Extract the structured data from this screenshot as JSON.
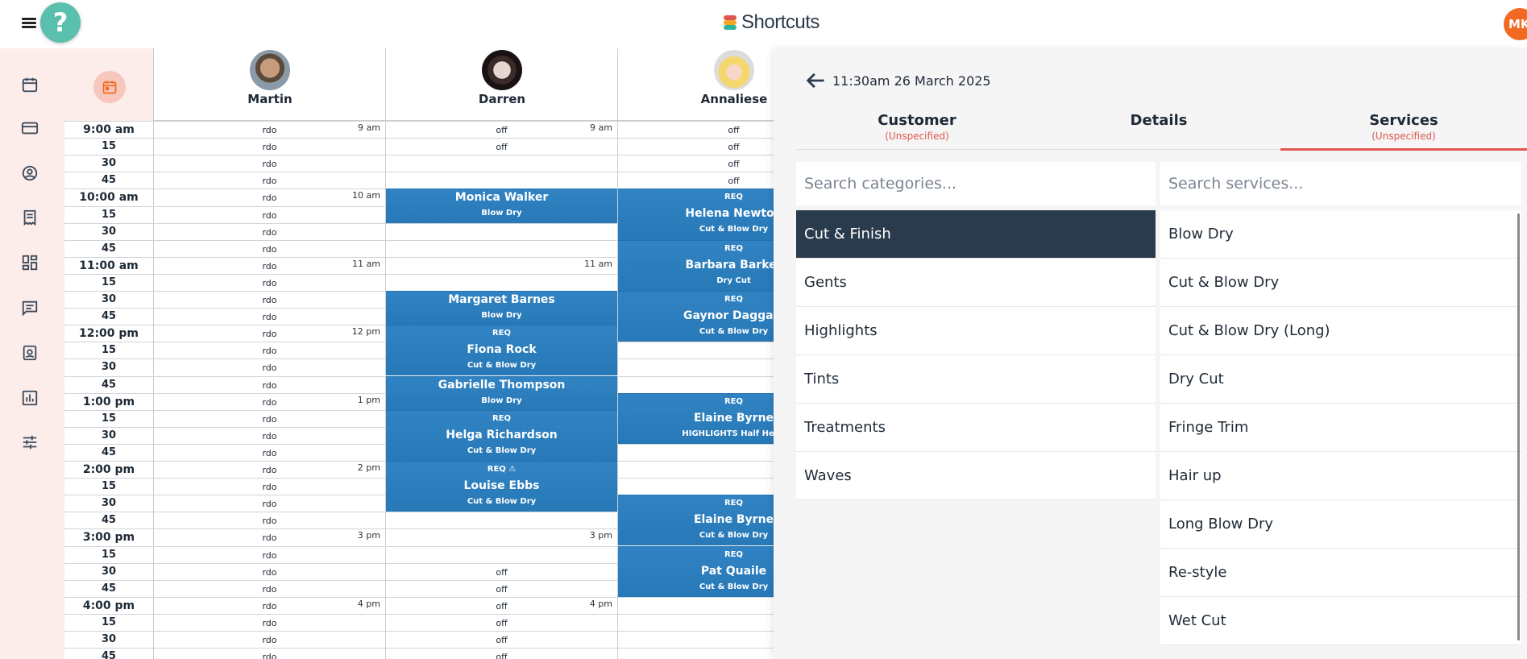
{
  "app": {
    "logo_text": "Shortcuts",
    "help_glyph": "?",
    "user_initials": "MK"
  },
  "icons": {
    "menu": "menu-icon",
    "help": "help-icon",
    "calendar": "calendar-icon",
    "card": "credit-card-icon",
    "customer": "user-circle-icon",
    "receipt": "receipt-icon",
    "dashboard": "dashboard-icon",
    "messages": "message-icon",
    "staff": "id-badge-icon",
    "reports": "bar-chart-icon",
    "settings": "sliders-icon",
    "back": "arrow-left-icon"
  },
  "colors": {
    "brand": "#e0574f",
    "help": "#5bbfae",
    "appointment": "#2a7fc1",
    "active_category": "#2b3b4e",
    "avatar": "#f26a21"
  },
  "staff": [
    {
      "name": "Martin"
    },
    {
      "name": "Darren"
    },
    {
      "name": "Annaliese"
    }
  ],
  "times": [
    "9:00 am",
    "15",
    "30",
    "45",
    "10:00 am",
    "15",
    "30",
    "45",
    "11:00 am",
    "15",
    "30",
    "45",
    "12:00 pm",
    "15",
    "30",
    "45",
    "1:00 pm",
    "15",
    "30",
    "45",
    "2:00 pm",
    "15",
    "30",
    "45",
    "3:00 pm",
    "15",
    "30",
    "45",
    "4:00 pm",
    "15",
    "30",
    "45"
  ],
  "hour_marks": {
    "0": "9 am",
    "4": "10 am",
    "8": "11 am",
    "12": "12 pm",
    "16": "1 pm",
    "20": "2 pm",
    "24": "3 pm",
    "28": "4 pm"
  },
  "columns": {
    "martin": {
      "rows": [
        "rdo",
        "rdo",
        "rdo",
        "rdo",
        "rdo",
        "rdo",
        "rdo",
        "rdo",
        "rdo",
        "rdo",
        "rdo",
        "rdo",
        "rdo",
        "rdo",
        "rdo",
        "rdo",
        "rdo",
        "rdo",
        "rdo",
        "rdo",
        "rdo",
        "rdo",
        "rdo",
        "rdo",
        "rdo",
        "rdo",
        "rdo",
        "rdo",
        "rdo",
        "rdo",
        "rdo",
        "rdo"
      ],
      "hour_mark_rows": [
        0,
        4,
        8,
        12,
        16,
        20,
        24,
        28
      ]
    },
    "darren": {
      "rows": [
        "off",
        "off",
        "",
        "",
        "",
        "",
        "",
        "",
        "",
        "",
        "",
        "",
        "",
        "",
        "",
        "",
        "",
        "",
        "",
        "",
        "",
        "",
        "",
        "",
        "",
        "",
        "off",
        "off",
        "off",
        "off",
        "off",
        "off"
      ],
      "hour_mark_rows": [
        0,
        8,
        24,
        28
      ]
    },
    "annaliese": {
      "rows": [
        "off",
        "off",
        "off",
        "off",
        "",
        "",
        "",
        "",
        "",
        "",
        "",
        "",
        "",
        "",
        "",
        "",
        "",
        "",
        "",
        "",
        "",
        "",
        "",
        "",
        "",
        "",
        "",
        "",
        "",
        "",
        "",
        ""
      ]
    }
  },
  "appointments": {
    "darren": [
      {
        "start": 4,
        "len": 2,
        "req": "",
        "name": "Monica Walker",
        "service": "Blow Dry"
      },
      {
        "start": 10,
        "len": 2,
        "req": "",
        "name": "Margaret Barnes",
        "service": "Blow Dry"
      },
      {
        "start": 12,
        "len": 3,
        "req": "REQ",
        "name": "Fiona Rock",
        "service": "Cut & Blow Dry"
      },
      {
        "start": 15,
        "len": 2,
        "req": "",
        "name": "Gabrielle Thompson",
        "service": "Blow Dry"
      },
      {
        "start": 17,
        "len": 3,
        "req": "REQ",
        "name": "Helga Richardson",
        "service": "Cut & Blow Dry"
      },
      {
        "start": 20,
        "len": 3,
        "req": "REQ ⚠",
        "name": "Louise Ebbs",
        "service": "Cut & Blow Dry"
      }
    ],
    "annaliese": [
      {
        "start": 4,
        "len": 3,
        "req": "REQ",
        "name": "Helena Newton",
        "service": "Cut & Blow Dry"
      },
      {
        "start": 7,
        "len": 3,
        "req": "REQ",
        "name": "Barbara Barker",
        "service": "Dry Cut"
      },
      {
        "start": 10,
        "len": 3,
        "req": "REQ",
        "name": "Gaynor Daggatt",
        "service": "Cut & Blow Dry"
      },
      {
        "start": 16,
        "len": 3,
        "req": "REQ",
        "name": "Elaine Byrne",
        "service": "HIGHLIGHTS Half Head"
      },
      {
        "start": 22,
        "len": 3,
        "req": "REQ",
        "name": "Elaine Byrne",
        "service": "Cut & Blow Dry"
      },
      {
        "start": 25,
        "len": 3,
        "req": "REQ",
        "name": "Pat Quaile",
        "service": "Cut & Blow Dry"
      }
    ]
  },
  "panel": {
    "datetime": "11:30am 26 March 2025",
    "tabs": [
      {
        "label": "Customer",
        "sub": "(Unspecified)"
      },
      {
        "label": "Details",
        "sub": ""
      },
      {
        "label": "Services",
        "sub": "(Unspecified)"
      }
    ],
    "active_tab": "Services",
    "category_search_placeholder": "Search categories...",
    "service_search_placeholder": "Search services...",
    "categories": [
      "Cut & Finish",
      "Gents",
      "Highlights",
      "Tints",
      "Treatments",
      "Waves"
    ],
    "active_category": "Cut & Finish",
    "services": [
      "Blow Dry",
      "Cut & Blow Dry",
      "Cut & Blow Dry (Long)",
      "Dry Cut",
      "Fringe Trim",
      "Hair up",
      "Long Blow Dry",
      "Re-style",
      "Wet Cut"
    ]
  }
}
